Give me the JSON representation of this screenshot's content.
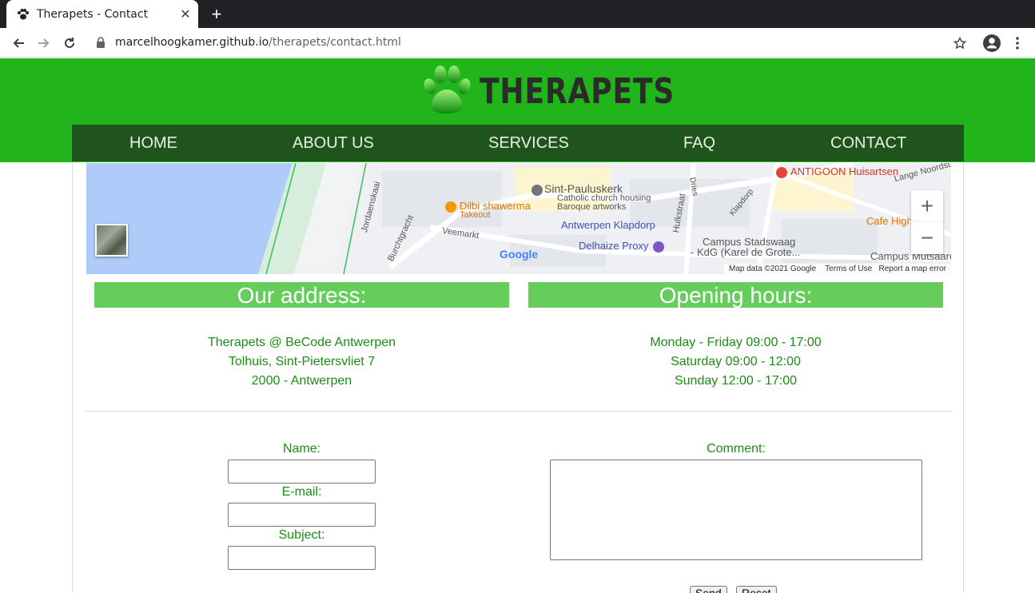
{
  "browser": {
    "tab_title": "Therapets - Contact",
    "url_host": "marcelhoogkamer.github.io",
    "url_path": "/therapets/contact.html"
  },
  "site": {
    "logo_text": "THERAPETS",
    "brand_green": "#22b41b",
    "nav_dark": "#1f551c",
    "nav": [
      "HOME",
      "ABOUT US",
      "SERVICES",
      "FAQ",
      "CONTACT"
    ]
  },
  "map": {
    "labels": {
      "antigoon": "ANTIGOON Huisartsen",
      "lange_noord": "Lange Noordst",
      "pauluskerk": "Sint-Pauluskerk",
      "pauluskerk_sub1": "Catholic church housing",
      "pauluskerk_sub2": "Baroque artworks",
      "dilbi": "Dilbi shawerma",
      "takeout": "Takeout",
      "cafe": "Cafe High",
      "jordaens": "Jordaenskaai",
      "burchtgracht": "Burchtgracht",
      "veemarkt": "Veemarkt",
      "dries": "Dries",
      "hulkstraat": "Hulkstraat",
      "klapdorp": "Klapdorp",
      "klapdorp_station": "Antwerpen Klapdorp",
      "delhaize": "Delhaize Proxy",
      "stadswaag1": "Campus Stadswaag",
      "stadswaag2": "- KdG (Karel de Grote...",
      "mutsaard": "Campus Mutsaard",
      "google": "Google"
    },
    "attribution": [
      "Map data ©2021 Google",
      "Terms of Use",
      "Report a map error"
    ]
  },
  "address": {
    "heading": "Our address:",
    "lines": [
      "Therapets @ BeCode Antwerpen",
      "Tolhuis, Sint-Pietersvliet 7",
      "2000 - Antwerpen"
    ]
  },
  "hours": {
    "heading": "Opening hours:",
    "lines": [
      "Monday - Friday 09:00 - 17:00",
      "Saturday 09:00 - 12:00",
      "Sunday 12:00 - 17:00"
    ]
  },
  "form": {
    "name_label": "Name:",
    "email_label": "E-mail:",
    "subject_label": "Subject:",
    "comment_label": "Comment:",
    "send_label": "Send",
    "reset_label": "Reset"
  }
}
